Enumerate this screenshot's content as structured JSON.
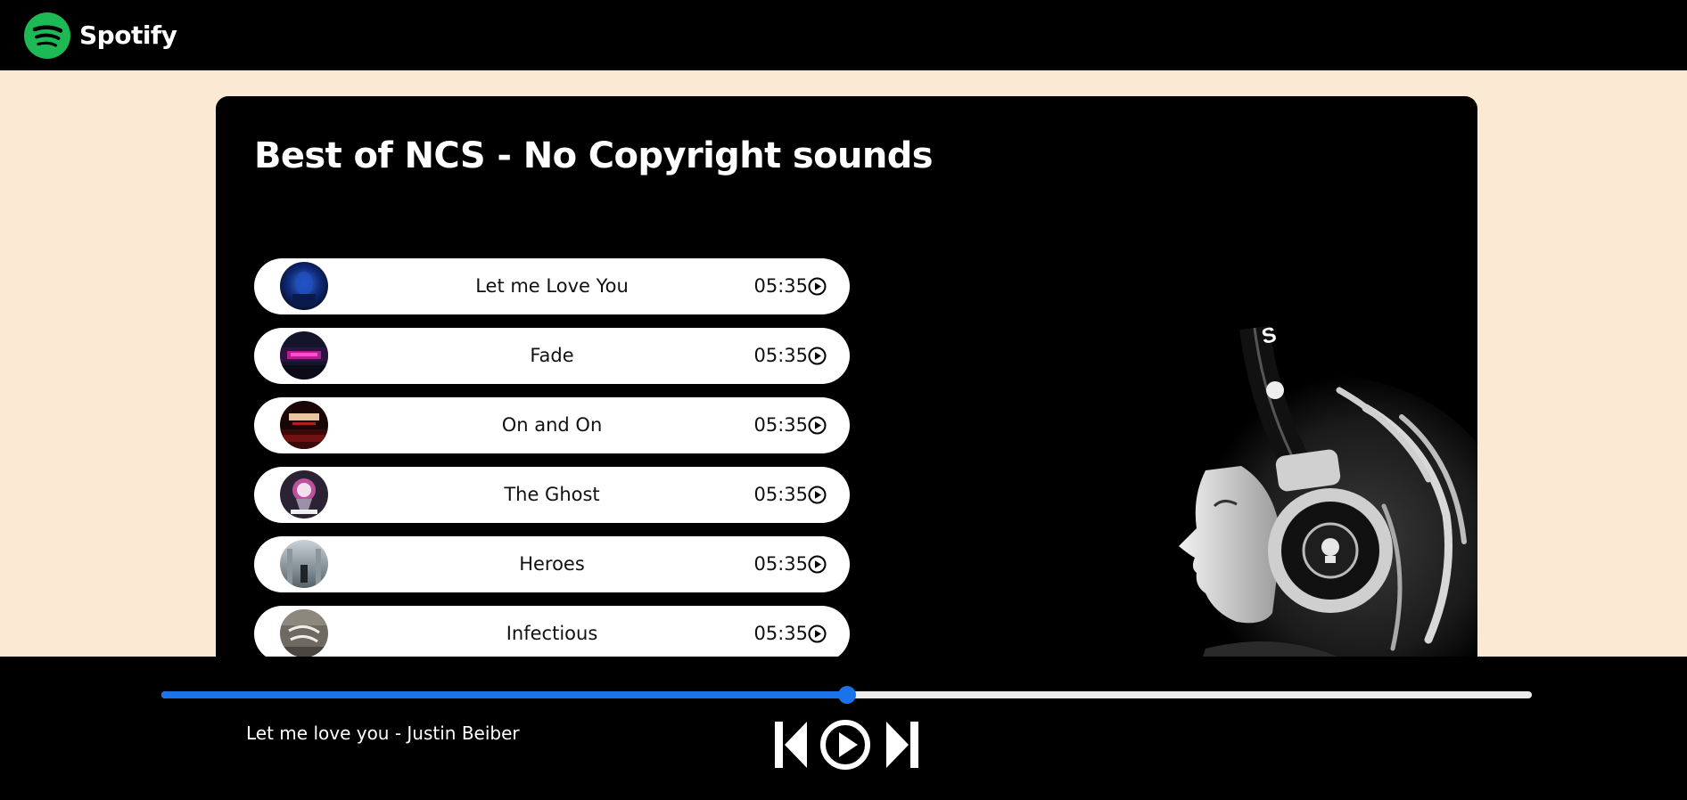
{
  "navbar": {
    "brand_name": "Spotify",
    "logo_icon": "spotify-logo-icon",
    "brand_color": "#1DB954"
  },
  "playlist": {
    "title": "Best of NCS - No Copyright sounds"
  },
  "songs": [
    {
      "name": "Let me Love You",
      "duration": "05:35",
      "cover_icon": "album-cover-icon",
      "play_icon": "play-circle-icon"
    },
    {
      "name": "Fade",
      "duration": "05:35",
      "cover_icon": "album-cover-icon",
      "play_icon": "play-circle-icon"
    },
    {
      "name": "On and On",
      "duration": "05:35",
      "cover_icon": "album-cover-icon",
      "play_icon": "play-circle-icon"
    },
    {
      "name": "The Ghost",
      "duration": "05:35",
      "cover_icon": "album-cover-icon",
      "play_icon": "play-circle-icon"
    },
    {
      "name": "Heroes",
      "duration": "05:35",
      "cover_icon": "album-cover-icon",
      "play_icon": "play-circle-icon"
    },
    {
      "name": "Infectious",
      "duration": "05:35",
      "cover_icon": "album-cover-icon",
      "play_icon": "play-circle-icon"
    }
  ],
  "player": {
    "now_playing": "Let me love you - Justin Beiber",
    "progress_fraction": 0.5,
    "progress_color": "#1A73E8",
    "track_color": "#EDEDED",
    "controls": [
      "previous-icon",
      "play-circle-icon",
      "next-icon"
    ]
  },
  "colors": {
    "page_background": "#FBE9D3",
    "panel_background": "#000000",
    "song_item_background": "#FFFFFF"
  }
}
